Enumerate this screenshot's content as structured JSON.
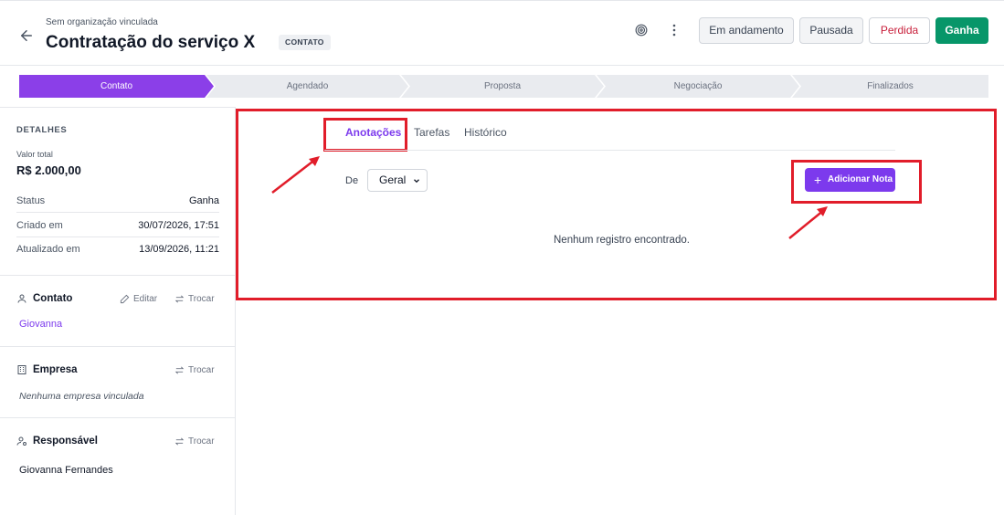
{
  "header": {
    "organization": "Sem organização vinculada",
    "title": "Contratação do serviço X",
    "stage_badge": "CONTATO",
    "buttons": {
      "in_progress": "Em andamento",
      "paused": "Pausada",
      "lost": "Perdida",
      "won": "Ganha"
    }
  },
  "pipeline": {
    "stages": [
      "Contato",
      "Agendado",
      "Proposta",
      "Negociação",
      "Finalizados"
    ],
    "active_index": 0
  },
  "details": {
    "section_title": "DETALHES",
    "total_label": "Valor total",
    "total_value": "R$ 2.000,00",
    "rows": [
      {
        "label": "Status",
        "value": "Ganha"
      },
      {
        "label": "Criado em",
        "value": "30/07/2026, 17:51"
      },
      {
        "label": "Atualizado em",
        "value": "13/09/2026, 11:21"
      }
    ]
  },
  "contact": {
    "title": "Contato",
    "edit_label": "Editar",
    "swap_label": "Trocar",
    "name": "Giovanna"
  },
  "company": {
    "title": "Empresa",
    "swap_label": "Trocar",
    "empty": "Nenhuma empresa vinculada"
  },
  "owner": {
    "title": "Responsável",
    "swap_label": "Trocar",
    "name": "Giovanna Fernandes"
  },
  "main": {
    "tabs": [
      "Anotações",
      "Tarefas",
      "Histórico"
    ],
    "active_tab": 0,
    "filter_label": "De",
    "filter_value": "Geral",
    "add_button": "Adicionar Nota",
    "empty_message": "Nenhum registro encontrado."
  },
  "colors": {
    "accent": "#7c3aed",
    "success": "#079669",
    "danger": "#c81e3a",
    "annotation": "#e11d2a"
  }
}
